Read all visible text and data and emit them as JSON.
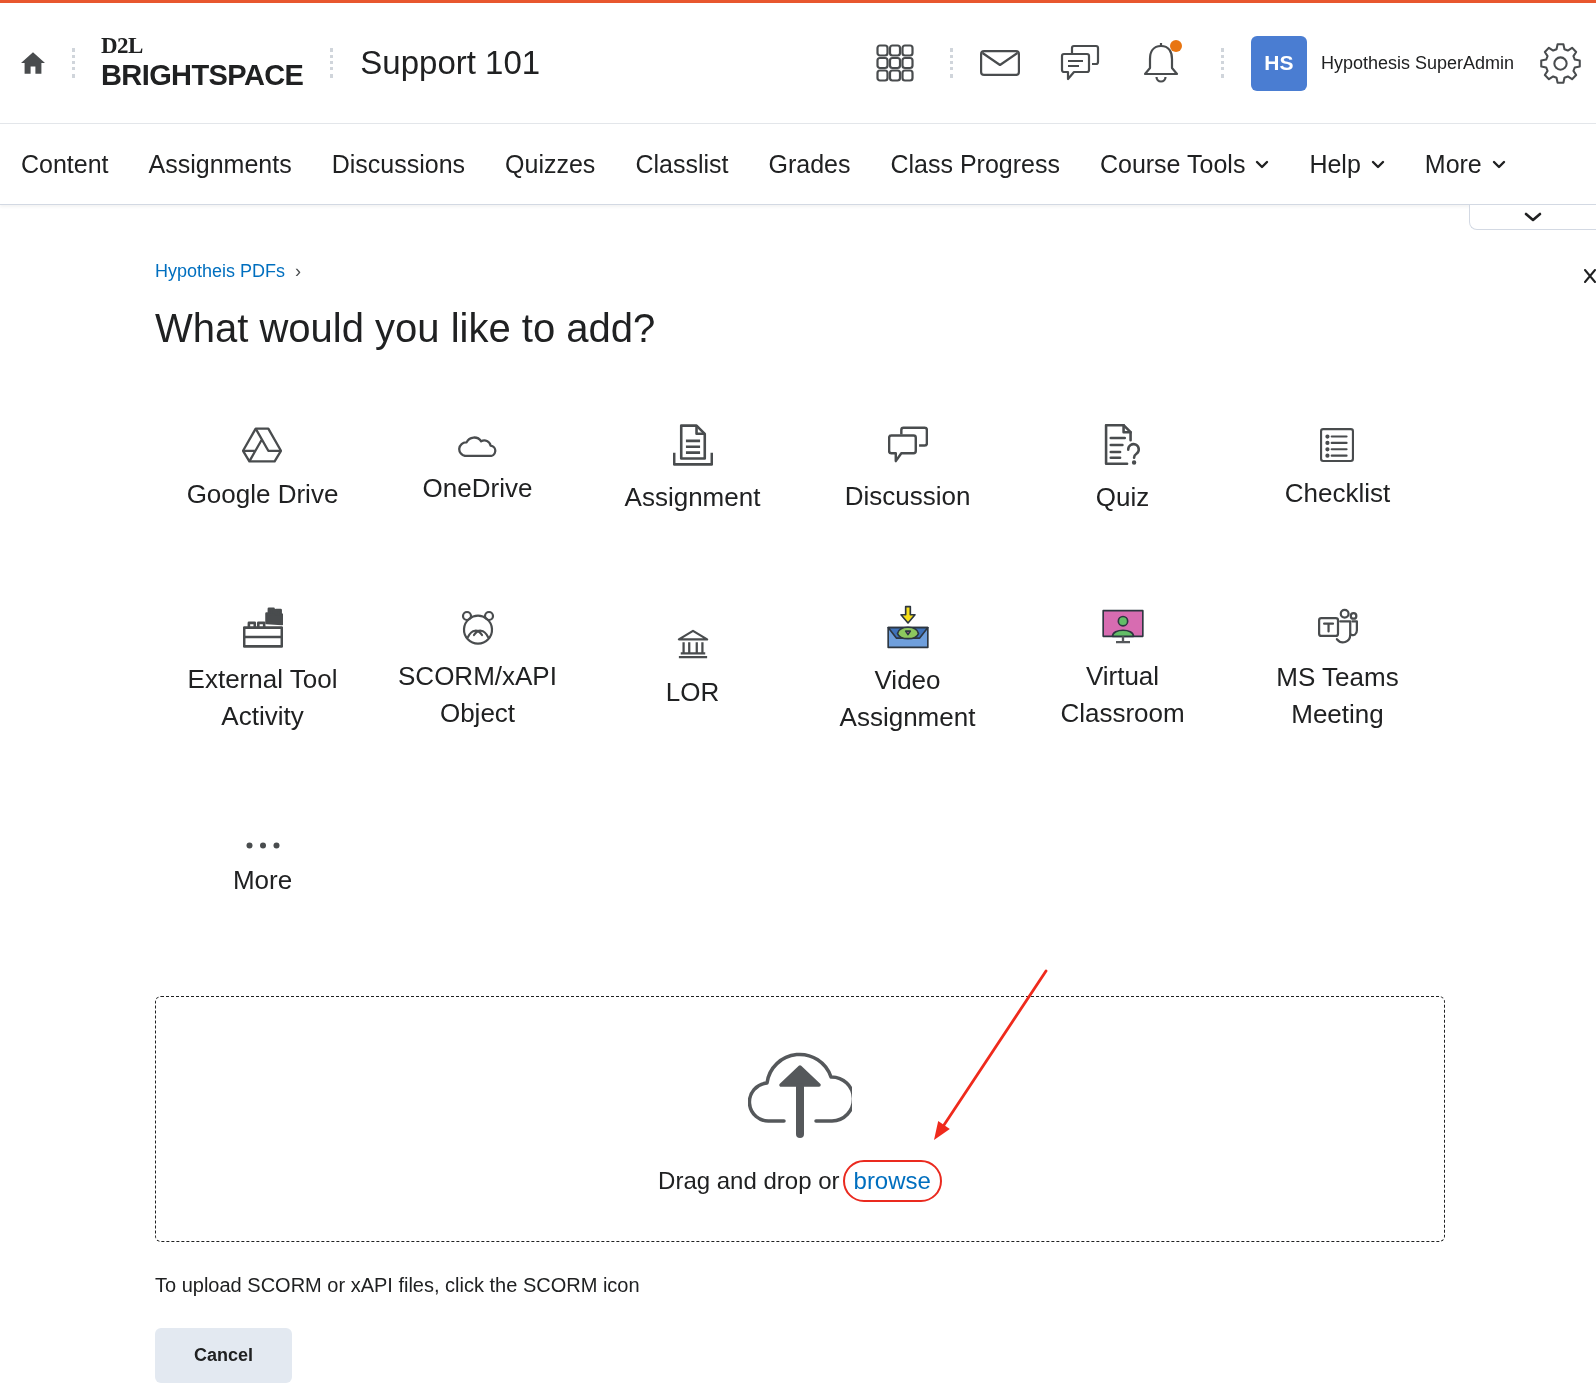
{
  "header": {
    "logo": {
      "mark": "D2L",
      "wordmark": "BRIGHTSPACE"
    },
    "course_title": "Support 101",
    "notifications_unread": true,
    "user": {
      "initials": "HS",
      "name": "Hypothesis SuperAdmin"
    }
  },
  "nav": {
    "items": [
      {
        "label": "Content",
        "kind": "link"
      },
      {
        "label": "Assignments",
        "kind": "link"
      },
      {
        "label": "Discussions",
        "kind": "link"
      },
      {
        "label": "Quizzes",
        "kind": "link"
      },
      {
        "label": "Classlist",
        "kind": "link"
      },
      {
        "label": "Grades",
        "kind": "link"
      },
      {
        "label": "Class Progress",
        "kind": "link"
      },
      {
        "label": "Course Tools",
        "kind": "menu"
      },
      {
        "label": "Help",
        "kind": "menu"
      },
      {
        "label": "More",
        "kind": "menu"
      }
    ]
  },
  "breadcrumb": {
    "link": "Hypotheis PDFs",
    "separator": "›"
  },
  "page": {
    "title": "What would you like to add?",
    "options": [
      {
        "label": "Google Drive"
      },
      {
        "label": "OneDrive"
      },
      {
        "label": "Assignment"
      },
      {
        "label": "Discussion"
      },
      {
        "label": "Quiz"
      },
      {
        "label": "Checklist"
      },
      {
        "label": "External Tool Activity"
      },
      {
        "label": "SCORM/xAPI Object"
      },
      {
        "label": "LOR"
      },
      {
        "label": "Video Assignment"
      },
      {
        "label": "Virtual Classroom"
      },
      {
        "label": "MS Teams Meeting"
      },
      {
        "label": "More"
      }
    ]
  },
  "dropzone": {
    "prompt": "Drag and drop or",
    "link": "browse",
    "link_highlighted": true
  },
  "note": "To upload SCORM or xAPI files, click the SCORM icon",
  "buttons": [
    {
      "label": "Cancel"
    }
  ]
}
